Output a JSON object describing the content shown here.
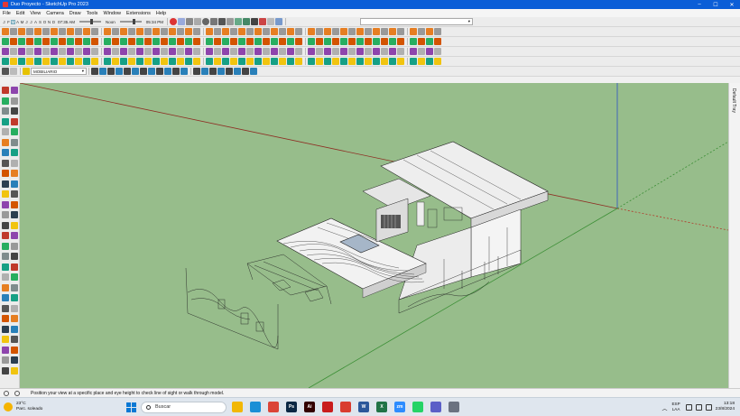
{
  "window": {
    "title": "Duo Proyecto - SketchUp Pro 2023"
  },
  "menu": [
    "File",
    "Edit",
    "View",
    "Camera",
    "Draw",
    "Tools",
    "Window",
    "Extensions",
    "Help"
  ],
  "shadow_bar": {
    "months": [
      "J",
      "F",
      "M",
      "A",
      "M",
      "J",
      "J",
      "A",
      "S",
      "O",
      "N",
      "D"
    ],
    "current_month_index": 2,
    "time_start": "07:35 AM",
    "time_mid": "Noon",
    "time_end": "05:34 PM"
  },
  "layer_dropdown": {
    "value": "MOBILIARIO"
  },
  "right_tray": {
    "label": "Default Tray"
  },
  "status": {
    "hint": "Position your view at a specific place and eye height to check line of sight or walk through model."
  },
  "taskbar": {
    "weather_temp": "23°C",
    "weather_desc": "Parc. soleado",
    "search_placeholder": "Buscar",
    "lang_top": "ESP",
    "lang_bottom": "LAA",
    "time": "13:18",
    "date": "23/8/2024"
  },
  "colors": {
    "viewport_bg": "#97bd8b",
    "titlebar": "#0b5ed7",
    "axis_red": "#b23a2a",
    "axis_green": "#3c8f36",
    "axis_blue": "#2e52c4"
  },
  "taskbar_apps": [
    {
      "icon": "file-explorer-icon",
      "color": "#f2b705",
      "label": ""
    },
    {
      "icon": "edge-icon",
      "color": "#1a8fd6",
      "label": ""
    },
    {
      "icon": "chrome-icon",
      "color": "#db4437",
      "label": ""
    },
    {
      "icon": "photoshop-icon",
      "color": "#0b2743",
      "label": "Ps"
    },
    {
      "icon": "illustrator-icon",
      "color": "#330000",
      "label": "Ai"
    },
    {
      "icon": "acrobat-icon",
      "color": "#c91c1c",
      "label": ""
    },
    {
      "icon": "sketchup-icon",
      "color": "#d93c2f",
      "label": ""
    },
    {
      "icon": "word-icon",
      "color": "#2b579a",
      "label": "W"
    },
    {
      "icon": "excel-icon",
      "color": "#217346",
      "label": "X"
    },
    {
      "icon": "zoom-icon",
      "color": "#2d8cff",
      "label": "zm"
    },
    {
      "icon": "whatsapp-icon",
      "color": "#25d366",
      "label": ""
    },
    {
      "icon": "teams-icon",
      "color": "#5b5fc7",
      "label": ""
    },
    {
      "icon": "settings-icon",
      "color": "#6b7280",
      "label": ""
    }
  ]
}
